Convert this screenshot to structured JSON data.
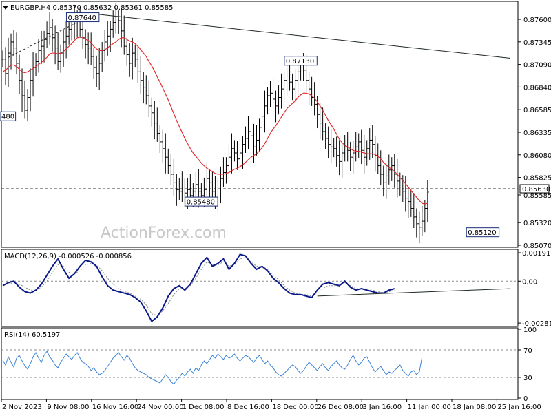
{
  "header": {
    "symbol": "EURGBP,H4",
    "ohlc": "0.85370 0.85632 0.85361 0.85585"
  },
  "watermark": "ActionForex.com",
  "colors": {
    "bg": "#ffffff",
    "price_bars": "#000000",
    "ma_line": "#e32b2b",
    "trendline": "#1f2a22",
    "macd_line": "#0a1a8a",
    "macd_signal": "#888888",
    "rsi_line": "#3b82d6",
    "grid_dash": "#8a8a8a"
  },
  "chart_data": [
    {
      "type": "line",
      "name": "price",
      "title": "EURGBP,H4 0.85370 0.85632 0.85361 0.85585",
      "ylim": [
        0.8496,
        0.8781
      ],
      "y_ticks": [
        "0.87600",
        "0.87345",
        "0.87090",
        "0.86840",
        "0.86585",
        "0.86335",
        "0.86080",
        "0.85825",
        "0.85585",
        "0.85320",
        "0.85070"
      ],
      "x_ticks": [
        "2 Nov 2023",
        "9 Nov 08:00",
        "16 Nov 16:00",
        "24 Nov 00:00",
        "1 Dec 08:00",
        "8 Dec 16:00",
        "18 Dec 00:00",
        "26 Dec 08:00",
        "3 Jan 16:00",
        "11 Jan 00:00",
        "18 Jan 08:00",
        "25 Jan 16:00"
      ],
      "annotations": [
        {
          "label": "0.87640",
          "x": 14.5,
          "y": 0.8764
        },
        {
          "label": "0.87130",
          "x": 54,
          "y": 0.8713
        },
        {
          "label": "0.85480",
          "x": 36,
          "y": 0.8548
        },
        {
          "label": "0.85120",
          "x": 87,
          "y": 0.8512
        },
        {
          "label": "480",
          "x": 0,
          "y": 0.8648
        }
      ],
      "hline": {
        "label": "0.85630",
        "value": 0.8563
      },
      "trendlines": [
        {
          "style": "solid",
          "from": [
            16.5,
            0.8768
          ],
          "to": [
            92,
            0.8716
          ]
        },
        {
          "style": "dashed",
          "from": [
            1,
            0.8717
          ],
          "to": [
            16.5,
            0.8768
          ]
        }
      ],
      "series": [
        {
          "name": "close",
          "x_start": 0,
          "x_step": 0.5,
          "values": [
            0.8715,
            0.8698,
            0.8722,
            0.8735,
            0.8728,
            0.871,
            0.869,
            0.8672,
            0.8655,
            0.867,
            0.869,
            0.8705,
            0.8712,
            0.8725,
            0.873,
            0.8738,
            0.8745,
            0.8752,
            0.874,
            0.8728,
            0.8712,
            0.8722,
            0.8735,
            0.8742,
            0.875,
            0.8755,
            0.876,
            0.8762,
            0.875,
            0.874,
            0.8732,
            0.8728,
            0.8718,
            0.8705,
            0.8698,
            0.871,
            0.8725,
            0.8735,
            0.8742,
            0.875,
            0.8758,
            0.8762,
            0.876,
            0.8748,
            0.873,
            0.872,
            0.871,
            0.8722,
            0.8715,
            0.87,
            0.869,
            0.8682,
            0.8672,
            0.866,
            0.8652,
            0.864,
            0.8628,
            0.8618,
            0.861,
            0.86,
            0.859,
            0.858,
            0.857,
            0.8562,
            0.856,
            0.8565,
            0.8558,
            0.8562,
            0.8555,
            0.856,
            0.8568,
            0.856,
            0.8555,
            0.8562,
            0.8575,
            0.857,
            0.856,
            0.8552,
            0.8565,
            0.8575,
            0.8582,
            0.859,
            0.86,
            0.861,
            0.8605,
            0.8598,
            0.8605,
            0.8615,
            0.8622,
            0.863,
            0.8625,
            0.8612,
            0.862,
            0.8635,
            0.8648,
            0.866,
            0.8672,
            0.8675,
            0.8668,
            0.866,
            0.867,
            0.868,
            0.869,
            0.8695,
            0.8688,
            0.868,
            0.869,
            0.87,
            0.8708,
            0.8702,
            0.869,
            0.868,
            0.867,
            0.8662,
            0.865,
            0.864,
            0.863,
            0.8622,
            0.8615,
            0.8612,
            0.861,
            0.8602,
            0.8595,
            0.8605,
            0.8612,
            0.8608,
            0.86,
            0.8605,
            0.8612,
            0.8618,
            0.8608,
            0.86,
            0.861,
            0.862,
            0.8615,
            0.8602,
            0.859,
            0.858,
            0.857,
            0.8578,
            0.8585,
            0.859,
            0.858,
            0.8572,
            0.8565,
            0.856,
            0.8552,
            0.8548,
            0.854,
            0.853,
            0.8522,
            0.8518,
            0.8525,
            0.854,
            0.8559
          ]
        },
        {
          "name": "MA",
          "x_start": 0,
          "x_step": 0.5,
          "values": [
            0.87,
            0.8702,
            0.8705,
            0.8708,
            0.8708,
            0.8706,
            0.8703,
            0.87,
            0.8699,
            0.87,
            0.8702,
            0.8704,
            0.8706,
            0.8709,
            0.8711,
            0.8714,
            0.8717,
            0.8721,
            0.8722,
            0.8722,
            0.8721,
            0.8722,
            0.8724,
            0.8727,
            0.873,
            0.8733,
            0.8737,
            0.874,
            0.8741,
            0.874,
            0.8738,
            0.8737,
            0.8734,
            0.873,
            0.8727,
            0.8725,
            0.8725,
            0.8726,
            0.8728,
            0.8731,
            0.8733,
            0.8735,
            0.8738,
            0.874,
            0.874,
            0.8738,
            0.8736,
            0.8735,
            0.8733,
            0.873,
            0.8726,
            0.8722,
            0.8718,
            0.8712,
            0.8707,
            0.8701,
            0.8694,
            0.8688,
            0.8681,
            0.8674,
            0.8667,
            0.8659,
            0.8651,
            0.8643,
            0.8636,
            0.8629,
            0.8622,
            0.8616,
            0.861,
            0.8605,
            0.8601,
            0.8597,
            0.8593,
            0.859,
            0.8587,
            0.8585,
            0.8583,
            0.8581,
            0.858,
            0.858,
            0.858,
            0.8581,
            0.8582,
            0.8584,
            0.8586,
            0.8587,
            0.8589,
            0.8591,
            0.8594,
            0.8597,
            0.86,
            0.8602,
            0.8604,
            0.8607,
            0.8611,
            0.8616,
            0.8622,
            0.8628,
            0.8633,
            0.8637,
            0.8642,
            0.8647,
            0.8652,
            0.8657,
            0.866,
            0.8663,
            0.8666,
            0.867,
            0.8673,
            0.8675,
            0.8675,
            0.8674,
            0.8672,
            0.8669,
            0.8665,
            0.866,
            0.8655,
            0.8649,
            0.8643,
            0.8638,
            0.8633,
            0.8627,
            0.8621,
            0.8617,
            0.8614,
            0.8612,
            0.861,
            0.8608,
            0.8607,
            0.8607,
            0.8606,
            0.8605,
            0.8604,
            0.8604,
            0.8604,
            0.8603,
            0.8601,
            0.8598,
            0.8594,
            0.8591,
            0.8588,
            0.8586,
            0.8583,
            0.858,
            0.8576,
            0.8573,
            0.8569,
            0.8565,
            0.8561,
            0.8557,
            0.8553,
            0.8549,
            0.8546,
            0.8545,
            0.8546
          ]
        }
      ]
    },
    {
      "type": "line",
      "name": "macd",
      "title": "MACD(12,26,9) -0.000526 -0.000856",
      "ylim": [
        -0.00295,
        0.00205
      ],
      "y_ticks": [
        "0.001911",
        "0.00",
        "-0.002816"
      ],
      "trendlines": [
        {
          "style": "solid",
          "from": [
            57,
            -0.001
          ],
          "to": [
            92,
            -0.0005
          ]
        }
      ],
      "series": [
        {
          "name": "MACD",
          "x_start": 0,
          "x_step": 1,
          "values": [
            -0.0003,
            -0.0001,
            0.0,
            -0.0004,
            -0.0007,
            -0.0008,
            -0.0006,
            -0.0002,
            0.0004,
            0.001,
            0.0015,
            0.0008,
            0.0002,
            0.0005,
            0.001,
            0.0014,
            0.0013,
            0.001,
            0.0003,
            -0.0003,
            -0.0006,
            -0.0007,
            -0.0008,
            -0.0009,
            -0.0011,
            -0.0014,
            -0.002,
            -0.0027,
            -0.0024,
            -0.0018,
            -0.001,
            -0.0005,
            -0.0003,
            -0.0006,
            -0.0002,
            0.0005,
            0.0012,
            0.0016,
            0.001,
            0.0012,
            0.0015,
            0.0008,
            0.0012,
            0.0018,
            0.0017,
            0.0012,
            0.0008,
            0.001,
            0.0007,
            0.0002,
            -0.0001,
            -0.0005,
            -0.0008,
            -0.0009,
            -0.0009,
            -0.001,
            -0.0011,
            -0.0006,
            -0.0002,
            -0.0001,
            -0.0002,
            -0.0003,
            0.0,
            -0.0004,
            -0.0006,
            -0.0005,
            -0.0006,
            -0.0007,
            -0.0008,
            -0.0008,
            -0.0006,
            -0.0005
          ]
        },
        {
          "name": "Signal",
          "x_start": 0,
          "x_step": 1,
          "values": [
            -0.0002,
            -0.0002,
            -0.0001,
            -0.0002,
            -0.0004,
            -0.0006,
            -0.0006,
            -0.0004,
            0.0,
            0.0006,
            0.0011,
            0.001,
            0.0006,
            0.0005,
            0.0007,
            0.0011,
            0.0012,
            0.0011,
            0.0007,
            0.0002,
            -0.0002,
            -0.0005,
            -0.0007,
            -0.0008,
            -0.001,
            -0.0012,
            -0.0016,
            -0.0022,
            -0.0023,
            -0.002,
            -0.0015,
            -0.0009,
            -0.0005,
            -0.0005,
            -0.0003,
            0.0002,
            0.0008,
            0.0013,
            0.0011,
            0.0011,
            0.0013,
            0.001,
            0.0011,
            0.0015,
            0.0016,
            0.0013,
            0.001,
            0.001,
            0.0008,
            0.0004,
            0.0001,
            -0.0003,
            -0.0006,
            -0.0008,
            -0.0009,
            -0.0009,
            -0.001,
            -0.0008,
            -0.0005,
            -0.0003,
            -0.0003,
            -0.0003,
            -0.0001,
            -0.0003,
            -0.0005,
            -0.0005,
            -0.0006,
            -0.0006,
            -0.0007,
            -0.0008,
            -0.0007,
            -0.0006
          ]
        }
      ]
    },
    {
      "type": "line",
      "name": "rsi",
      "title": "RSI(14) 60.5197",
      "ylim": [
        0,
        100
      ],
      "y_ticks": [
        "100",
        "70",
        "30",
        "0"
      ],
      "levels": [
        70,
        30
      ],
      "series": [
        {
          "name": "RSI",
          "x_start": 0,
          "x_step": 0.5,
          "values": [
            55,
            48,
            60,
            52,
            45,
            58,
            62,
            54,
            47,
            42,
            50,
            60,
            66,
            58,
            52,
            62,
            68,
            60,
            55,
            48,
            44,
            52,
            58,
            64,
            60,
            56,
            62,
            66,
            58,
            52,
            50,
            46,
            40,
            44,
            38,
            34,
            36,
            40,
            46,
            52,
            58,
            62,
            66,
            60,
            55,
            62,
            58,
            50,
            44,
            40,
            38,
            36,
            34,
            30,
            28,
            26,
            24,
            22,
            28,
            34,
            30,
            24,
            20,
            26,
            30,
            36,
            32,
            38,
            42,
            36,
            44,
            40,
            48,
            54,
            50,
            56,
            62,
            58,
            64,
            60,
            56,
            62,
            58,
            60,
            64,
            58,
            54,
            58,
            62,
            60,
            56,
            52,
            58,
            62,
            56,
            50,
            54,
            48,
            44,
            38,
            34,
            32,
            36,
            40,
            44,
            48,
            46,
            40,
            36,
            40,
            46,
            52,
            48,
            44,
            40,
            46,
            50,
            44,
            40,
            46,
            50,
            54,
            48,
            44,
            42,
            48,
            56,
            62,
            54,
            48,
            52,
            58,
            60,
            52,
            44,
            38,
            42,
            46,
            40,
            34,
            38,
            36,
            40,
            44,
            48,
            40,
            36,
            32,
            38,
            40,
            34,
            38,
            60
          ]
        }
      ]
    }
  ]
}
